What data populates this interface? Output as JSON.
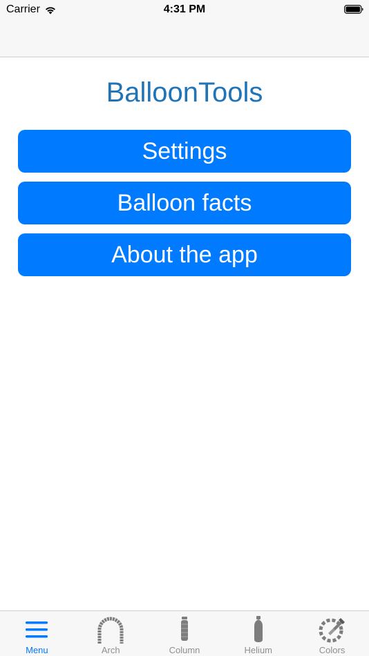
{
  "status_bar": {
    "carrier": "Carrier",
    "time": "4:31 PM",
    "wifi_icon": "wifi-icon",
    "battery_icon": "battery-icon"
  },
  "main": {
    "title": "BalloonTools",
    "title_color": "#1f73b7",
    "button_color": "#007aff",
    "buttons": [
      {
        "label": "Settings"
      },
      {
        "label": "Balloon facts"
      },
      {
        "label": "About the app"
      }
    ]
  },
  "tab_bar": {
    "active_color": "#007aff",
    "inactive_color": "#8e8e93",
    "tabs": [
      {
        "label": "Menu",
        "icon": "menu-icon",
        "active": true
      },
      {
        "label": "Arch",
        "icon": "arch-icon",
        "active": false
      },
      {
        "label": "Column",
        "icon": "column-icon",
        "active": false
      },
      {
        "label": "Helium",
        "icon": "helium-balloon-icon",
        "active": false
      },
      {
        "label": "Colors",
        "icon": "colors-icon",
        "active": false
      }
    ]
  }
}
